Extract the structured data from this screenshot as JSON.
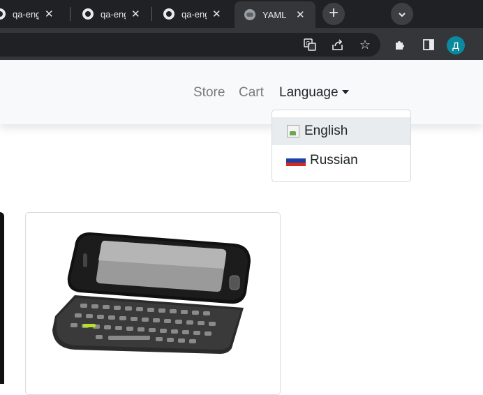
{
  "browser": {
    "tabs": [
      {
        "title": "qa-engineer-test",
        "icon": "github-icon"
      },
      {
        "title": "qa-engineer-test",
        "icon": "github-icon"
      },
      {
        "title": "qa-engineer-test",
        "icon": "github-icon"
      },
      {
        "title": "YAML",
        "icon": "globe-icon"
      }
    ],
    "new_tab_symbol": "+",
    "tab_search_symbol": "⌄",
    "profile_initial": "Д"
  },
  "navbar": {
    "links": [
      "Store",
      "Cart"
    ],
    "language_label": "Language"
  },
  "language_dropdown": {
    "items": [
      {
        "label": "English",
        "icon": "broken-image-icon"
      },
      {
        "label": "Russian",
        "icon": "russia-flag-icon"
      }
    ]
  },
  "colors": {
    "chrome_dark": "#202124",
    "toolbar": "#35363a",
    "navbar_bg": "#f8f9fa",
    "hover_bg": "#e9ecef",
    "profile": "#0b8a9d"
  }
}
